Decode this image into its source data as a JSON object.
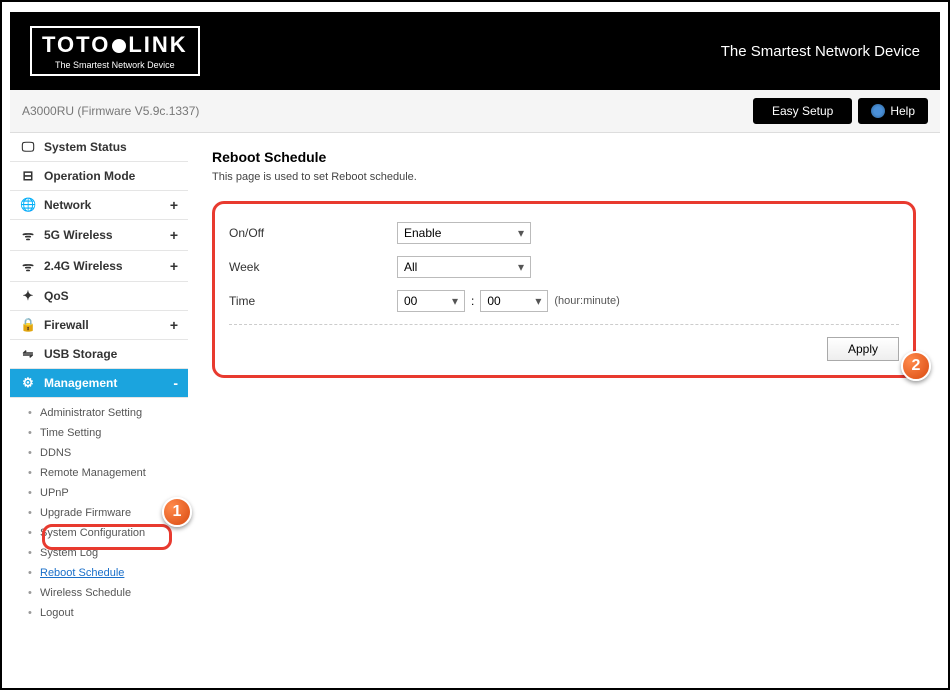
{
  "header": {
    "logo_left": "TOTO",
    "logo_right": "LINK",
    "logo_sub": "The Smartest Network Device",
    "slogan": "The Smartest Network Device"
  },
  "subbar": {
    "model": "A3000RU (Firmware V5.9c.1337)",
    "easy_setup": "Easy Setup",
    "help": "Help"
  },
  "nav": {
    "system_status": "System Status",
    "operation_mode": "Operation Mode",
    "network": "Network",
    "wireless5g": "5G Wireless",
    "wireless24g": "2.4G Wireless",
    "qos": "QoS",
    "firewall": "Firewall",
    "usb_storage": "USB Storage",
    "management": "Management"
  },
  "subnav": {
    "admin_setting": "Administrator Setting",
    "time_setting": "Time Setting",
    "ddns": "DDNS",
    "remote_mgmt": "Remote Management",
    "upnp": "UPnP",
    "upgrade_fw": "Upgrade Firmware",
    "sys_config": "System Configuration",
    "sys_log": "System Log",
    "reboot_schedule": "Reboot Schedule",
    "wireless_schedule": "Wireless Schedule",
    "logout": "Logout"
  },
  "page": {
    "title": "Reboot Schedule",
    "desc": "This page is used to set Reboot schedule."
  },
  "form": {
    "onoff_label": "On/Off",
    "onoff_value": "Enable",
    "week_label": "Week",
    "week_value": "All",
    "time_label": "Time",
    "hour_value": "00",
    "minute_value": "00",
    "colon": ":",
    "time_hint": "(hour:minute)",
    "apply": "Apply"
  },
  "callouts": {
    "one": "1",
    "two": "2"
  }
}
